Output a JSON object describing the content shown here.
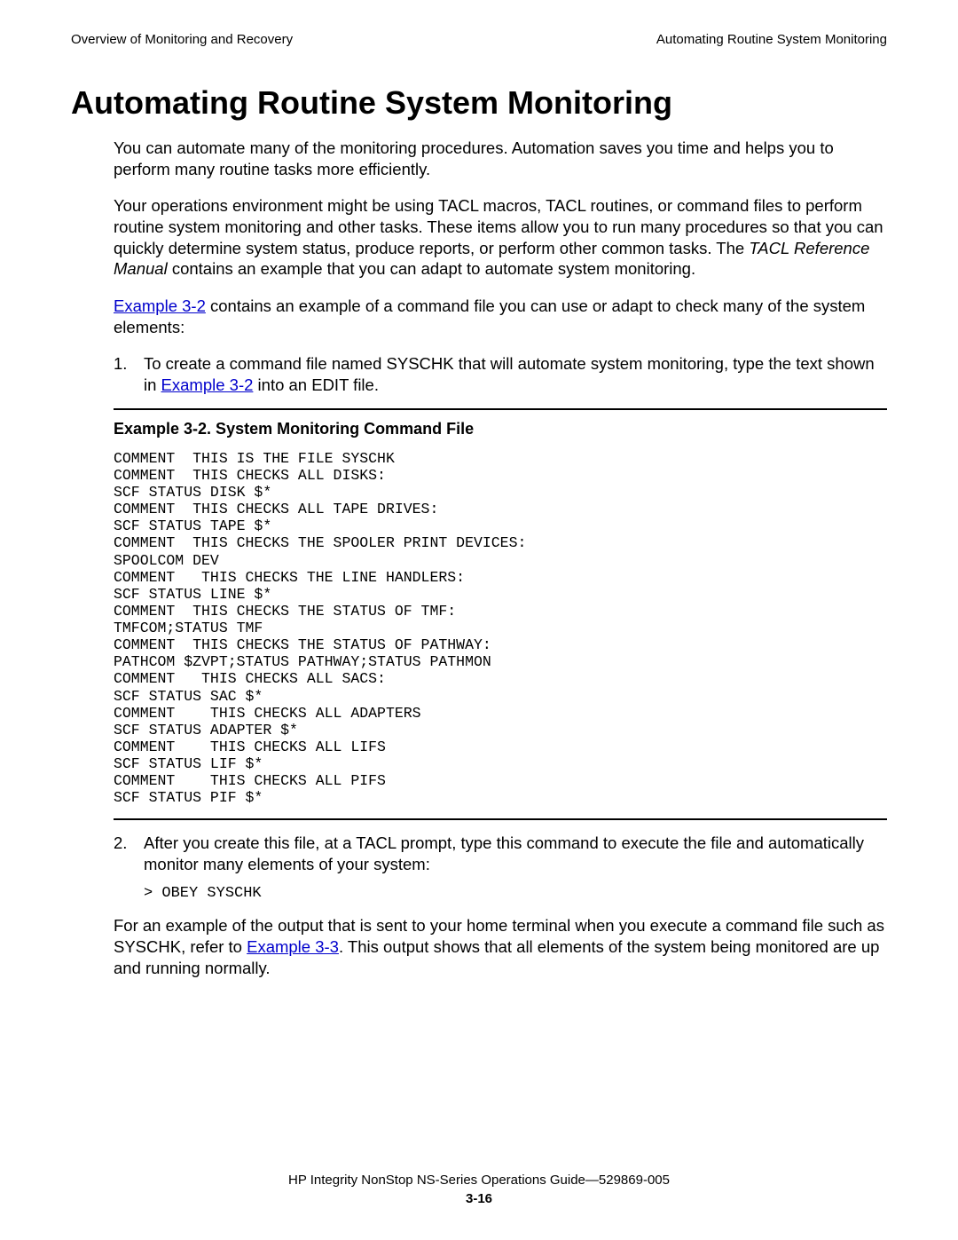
{
  "header": {
    "left": "Overview of Monitoring and Recovery",
    "right": "Automating Routine System Monitoring"
  },
  "title": "Automating Routine System Monitoring",
  "para1": "You can automate many of the monitoring procedures. Automation saves you time and helps you to perform many routine tasks more efficiently.",
  "para2a": "Your operations environment might be using TACL macros, TACL routines, or command files to perform routine system monitoring and other tasks. These items allow you to run many procedures so that you can quickly determine system status, produce reports, or perform other common tasks. The ",
  "para2_italic": "TACL Reference Manual",
  "para2b": " contains an example that you can adapt to automate system monitoring.",
  "para3_link": "Example 3-2",
  "para3_rest": " contains an example of a command file you can use or adapt to check many of the system elements:",
  "ol1_num": "1.",
  "ol1_a": "To create a command file named SYSCHK that will automate system monitoring, type the text shown in ",
  "ol1_link": "Example 3-2",
  "ol1_b": " into an EDIT file.",
  "example_title": "Example 3-2.  System Monitoring Command File",
  "example_code": "COMMENT  THIS IS THE FILE SYSCHK\nCOMMENT  THIS CHECKS ALL DISKS:\nSCF STATUS DISK $*\nCOMMENT  THIS CHECKS ALL TAPE DRIVES:\nSCF STATUS TAPE $*\nCOMMENT  THIS CHECKS THE SPOOLER PRINT DEVICES:\nSPOOLCOM DEV\nCOMMENT   THIS CHECKS THE LINE HANDLERS:\nSCF STATUS LINE $*\nCOMMENT  THIS CHECKS THE STATUS OF TMF:\nTMFCOM;STATUS TMF\nCOMMENT  THIS CHECKS THE STATUS OF PATHWAY:\nPATHCOM $ZVPT;STATUS PATHWAY;STATUS PATHMON\nCOMMENT   THIS CHECKS ALL SACS:\nSCF STATUS SAC $*\nCOMMENT    THIS CHECKS ALL ADAPTERS\nSCF STATUS ADAPTER $*\nCOMMENT    THIS CHECKS ALL LIFS\nSCF STATUS LIF $*\nCOMMENT    THIS CHECKS ALL PIFS\nSCF STATUS PIF $*",
  "ol2_num": "2.",
  "ol2_text": "After you create this file, at a TACL prompt, type this command to execute the file and automatically monitor many elements of your system:",
  "obey_cmd": "> OBEY SYSCHK",
  "para4a": "For an example of the output that is sent to your home terminal when you execute a command file such as SYSCHK, refer to ",
  "para4_link": "Example 3-3",
  "para4b": ". This output shows that all elements of the system being monitored are up and running normally.",
  "footer": {
    "line": "HP Integrity NonStop NS-Series Operations Guide—529869-005",
    "pageno": "3-16"
  }
}
